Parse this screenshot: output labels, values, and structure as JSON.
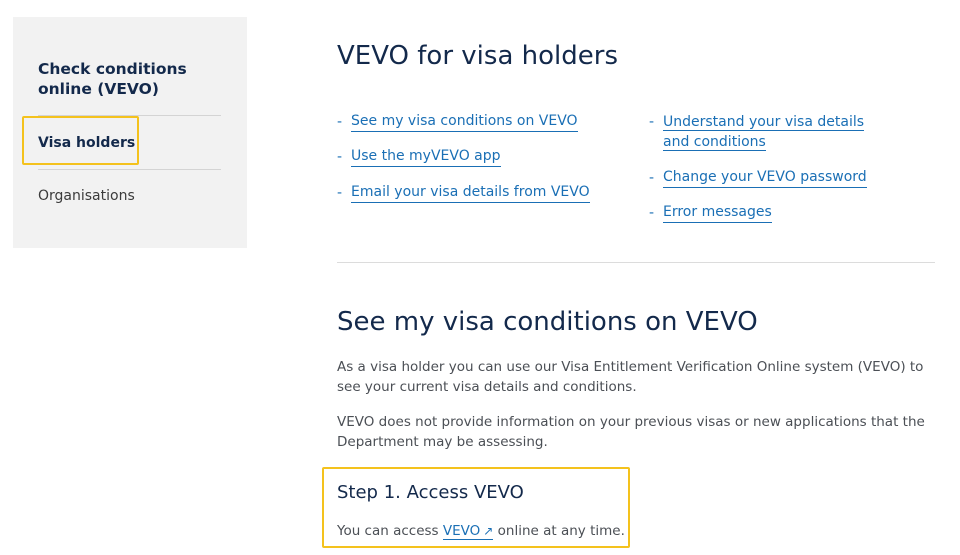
{
  "sidebar": {
    "title": "Check conditions online (VEVO)",
    "items": [
      {
        "label": "Visa holders",
        "active": true
      },
      {
        "label": "Organisations",
        "active": false
      }
    ]
  },
  "main": {
    "title": "VEVO for visa holders",
    "links_left": [
      "See my visa conditions on VEVO",
      "Use the myVEVO app",
      "Email your visa details from VEVO"
    ],
    "links_right": [
      "Understand your visa details and conditions",
      "Change your VEVO password",
      "Error messages"
    ],
    "section_title": "See my visa conditions on VEVO",
    "para1": "As a visa holder you can use our Visa Entitlement Verification Online system (VEVO) to see your current visa details and conditions.",
    "para2": "VEVO does not provide information on your previous visas or new applications that the Department may be assessing.",
    "step": {
      "title": "Step 1. Access VEVO",
      "text_before": "You can access ",
      "link": "VEVO",
      "link_icon": "external-link-icon",
      "text_after": " online at any time."
    }
  },
  "colors": {
    "link": "#1a6fb5",
    "heading": "#13294b",
    "highlight": "#f4c21d",
    "sidebar_bg": "#f2f2f2"
  }
}
